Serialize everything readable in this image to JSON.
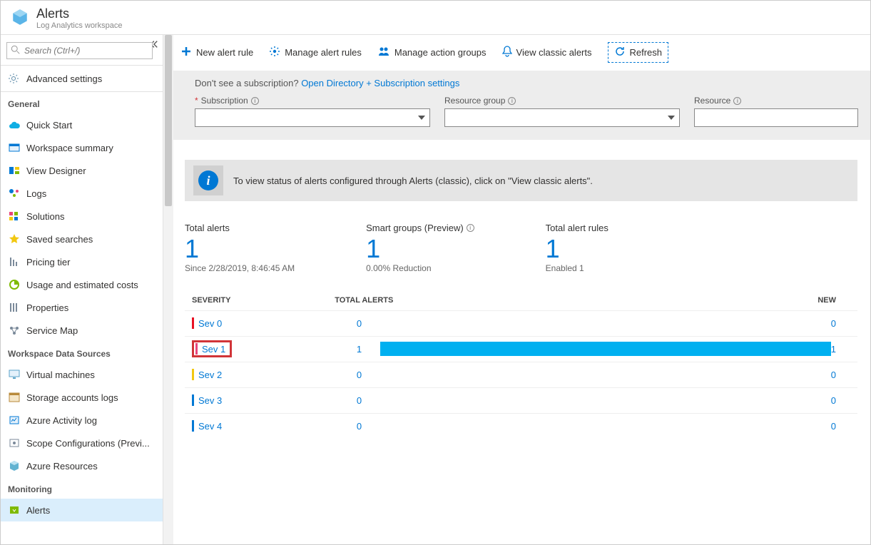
{
  "header": {
    "title": "Alerts",
    "subtitle": "Log Analytics workspace"
  },
  "search": {
    "placeholder": "Search (Ctrl+/)"
  },
  "nav_top": {
    "advanced": "Advanced settings"
  },
  "sections": [
    {
      "title": "General",
      "items": [
        {
          "label": "Quick Start",
          "icon": "cloud",
          "color": "#0faee4"
        },
        {
          "label": "Workspace summary",
          "icon": "summary",
          "color": "#0078d4"
        },
        {
          "label": "View Designer",
          "icon": "designer",
          "color": "#0078d4"
        },
        {
          "label": "Logs",
          "icon": "logs",
          "color": "#0078d4"
        },
        {
          "label": "Solutions",
          "icon": "solutions",
          "color": "#e8467c"
        },
        {
          "label": "Saved searches",
          "icon": "star",
          "color": "#f2c811"
        },
        {
          "label": "Pricing tier",
          "icon": "pricing",
          "color": "#7b8a9a"
        },
        {
          "label": "Usage and estimated costs",
          "icon": "usage",
          "color": "#7fba00"
        },
        {
          "label": "Properties",
          "icon": "properties",
          "color": "#7b8a9a"
        },
        {
          "label": "Service Map",
          "icon": "servicemap",
          "color": "#7b8a9a"
        }
      ]
    },
    {
      "title": "Workspace Data Sources",
      "items": [
        {
          "label": "Virtual machines",
          "icon": "vm",
          "color": "#5aa2c8"
        },
        {
          "label": "Storage accounts logs",
          "icon": "storage",
          "color": "#b88a3b"
        },
        {
          "label": "Azure Activity log",
          "icon": "activity",
          "color": "#0078d4"
        },
        {
          "label": "Scope Configurations (Previ...",
          "icon": "scope",
          "color": "#7b8a9a"
        },
        {
          "label": "Azure Resources",
          "icon": "resources",
          "color": "#62b3d1"
        }
      ]
    },
    {
      "title": "Monitoring",
      "items": [
        {
          "label": "Alerts",
          "icon": "alerts",
          "color": "#7fba00",
          "active": true
        }
      ]
    }
  ],
  "toolbar": {
    "new_rule": "New alert rule",
    "manage_rules": "Manage alert rules",
    "manage_groups": "Manage action groups",
    "view_classic": "View classic alerts",
    "refresh": "Refresh"
  },
  "filterbar": {
    "hint_prefix": "Don't see a subscription? ",
    "hint_link": "Open Directory + Subscription settings",
    "subscription": "Subscription",
    "resource_group": "Resource group",
    "resource": "Resource"
  },
  "banner": {
    "text": "To view status of alerts configured through Alerts (classic), click on \"View classic alerts\"."
  },
  "stats": {
    "total_alerts": {
      "title": "Total alerts",
      "value": "1",
      "sub": "Since 2/28/2019, 8:46:45 AM"
    },
    "smart_groups": {
      "title": "Smart groups (Preview)",
      "value": "1",
      "sub": "0.00% Reduction"
    },
    "total_rules": {
      "title": "Total alert rules",
      "value": "1",
      "sub": "Enabled 1"
    }
  },
  "table": {
    "headers": {
      "severity": "Severity",
      "total": "Total Alerts",
      "new": "New"
    },
    "rows": [
      {
        "sev": "Sev 0",
        "color": "#e81123",
        "total": "0",
        "new": "0",
        "bar": 0,
        "highlight": false
      },
      {
        "sev": "Sev 1",
        "color": "#e8467c",
        "total": "1",
        "new": "1",
        "bar": 1,
        "highlight": true
      },
      {
        "sev": "Sev 2",
        "color": "#f2c811",
        "total": "0",
        "new": "0",
        "bar": 0,
        "highlight": false
      },
      {
        "sev": "Sev 3",
        "color": "#0078d4",
        "total": "0",
        "new": "0",
        "bar": 0,
        "highlight": false
      },
      {
        "sev": "Sev 4",
        "color": "#0078d4",
        "total": "0",
        "new": "0",
        "bar": 0,
        "highlight": false
      }
    ]
  }
}
